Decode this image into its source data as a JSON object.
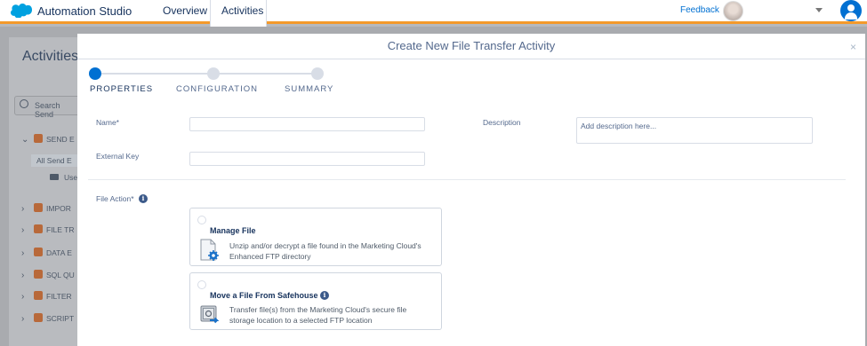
{
  "header": {
    "app_name": "Automation Studio",
    "tabs": [
      {
        "label": "Overview",
        "active": false
      },
      {
        "label": "Activities",
        "active": true
      }
    ],
    "feedback_label": "Feedback",
    "accent_color": "#f49a2b",
    "brand_color": "#0070d2"
  },
  "background_page": {
    "title": "Activities",
    "search_placeholder": "Search Send",
    "rows": [
      {
        "label": "SEND E",
        "expanded": true
      },
      {
        "label": "IMPOR",
        "expanded": false
      },
      {
        "label": "FILE TR",
        "expanded": false
      },
      {
        "label": "DATA E",
        "expanded": false
      },
      {
        "label": "SQL QU",
        "expanded": false
      },
      {
        "label": "FILTER",
        "expanded": false
      },
      {
        "label": "SCRIPT",
        "expanded": false
      }
    ],
    "selected_row": "All Send E",
    "sub_row": "Use"
  },
  "modal": {
    "title": "Create New File Transfer Activity",
    "close_glyph": "×",
    "steps": [
      {
        "label": "PROPERTIES",
        "active": true
      },
      {
        "label": "CONFIGURATION",
        "active": false
      },
      {
        "label": "SUMMARY",
        "active": false
      }
    ],
    "fields": {
      "name_label": "Name*",
      "name_value": "",
      "external_key_label": "External Key",
      "external_key_value": "",
      "description_label": "Description",
      "description_placeholder": "Add description here...",
      "file_action_label": "File Action*"
    },
    "options": [
      {
        "title": "Manage File",
        "description_line1": "Unzip and/or decrypt a file found in the Marketing Cloud's",
        "description_line2": "Enhanced FTP directory",
        "icon": "file-gear-icon",
        "selected": false
      },
      {
        "title": "Move a File From Safehouse",
        "description_line1": "Transfer file(s) from the Marketing Cloud's secure file",
        "description_line2": "storage location to a selected FTP location",
        "icon": "safe-transfer-icon",
        "selected": false
      }
    ]
  }
}
